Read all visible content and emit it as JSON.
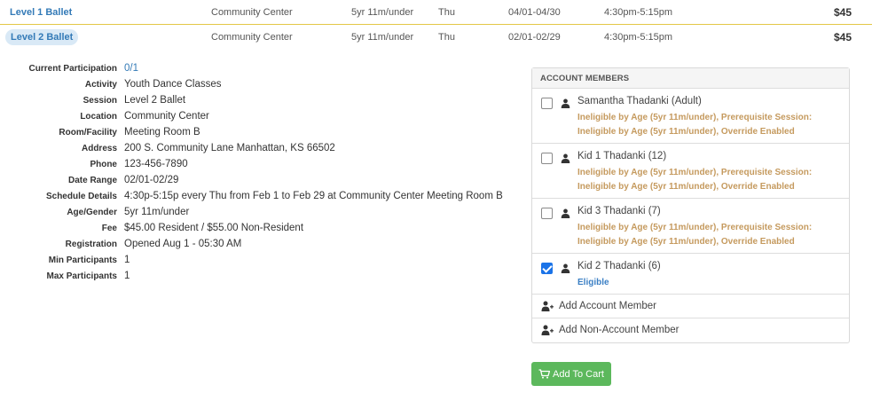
{
  "sessions": [
    {
      "name": "Level 1 Ballet",
      "location": "Community Center",
      "age": "5yr 11m/under",
      "day": "Thu",
      "dates": "04/01-04/30",
      "time": "4:30pm-5:15pm",
      "price": "$45"
    },
    {
      "name": "Level 2 Ballet",
      "location": "Community Center",
      "age": "5yr 11m/under",
      "day": "Thu",
      "dates": "02/01-02/29",
      "time": "4:30pm-5:15pm",
      "price": "$45"
    }
  ],
  "details": [
    {
      "label": "Current Participation",
      "value": "0/1"
    },
    {
      "label": "Activity",
      "value": "Youth Dance Classes"
    },
    {
      "label": "Session",
      "value": "Level 2 Ballet"
    },
    {
      "label": "Location",
      "value": "Community Center"
    },
    {
      "label": "Room/Facility",
      "value": "Meeting Room B"
    },
    {
      "label": "Address",
      "value": "200 S. Community Lane Manhattan, KS 66502"
    },
    {
      "label": "Phone",
      "value": "123-456-7890"
    },
    {
      "label": "Date Range",
      "value": "02/01-02/29"
    },
    {
      "label": "Schedule Details",
      "value": "4:30p-5:15p every Thu from Feb 1 to Feb 29 at Community Center Meeting Room B"
    },
    {
      "label": "Age/Gender",
      "value": "5yr 11m/under"
    },
    {
      "label": "Fee",
      "value": "$45.00 Resident / $55.00 Non-Resident"
    },
    {
      "label": "Registration",
      "value": "Opened Aug 1 - 05:30 AM"
    },
    {
      "label": "Min Participants",
      "value": "1"
    },
    {
      "label": "Max Participants",
      "value": "1"
    }
  ],
  "account_panel": {
    "title": "ACCOUNT MEMBERS",
    "members": [
      {
        "name": "Samantha Thadanki (Adult)",
        "status": "Ineligible by Age (5yr 11m/under), Prerequisite Session: Ineligible by Age (5yr 11m/under), Override Enabled",
        "checked": false
      },
      {
        "name": "Kid 1 Thadanki (12)",
        "status": "Ineligible by Age (5yr 11m/under), Prerequisite Session: Ineligible by Age (5yr 11m/under), Override Enabled",
        "checked": false
      },
      {
        "name": "Kid 3 Thadanki (7)",
        "status": "Ineligible by Age (5yr 11m/under), Prerequisite Session: Ineligible by Age (5yr 11m/under), Override Enabled",
        "checked": false
      },
      {
        "name": "Kid 2 Thadanki (6)",
        "status": "Eligible",
        "checked": true
      }
    ],
    "add_member_label": "Add Account Member",
    "add_non_member_label": "Add Non-Account Member"
  },
  "cart_button_label": "Add To Cart",
  "colors": {
    "link": "#337ab7",
    "warning": "#c59a5e",
    "eligible": "#3b7fc4",
    "success": "#5cb85c",
    "checkbox": "#1a73e8"
  }
}
